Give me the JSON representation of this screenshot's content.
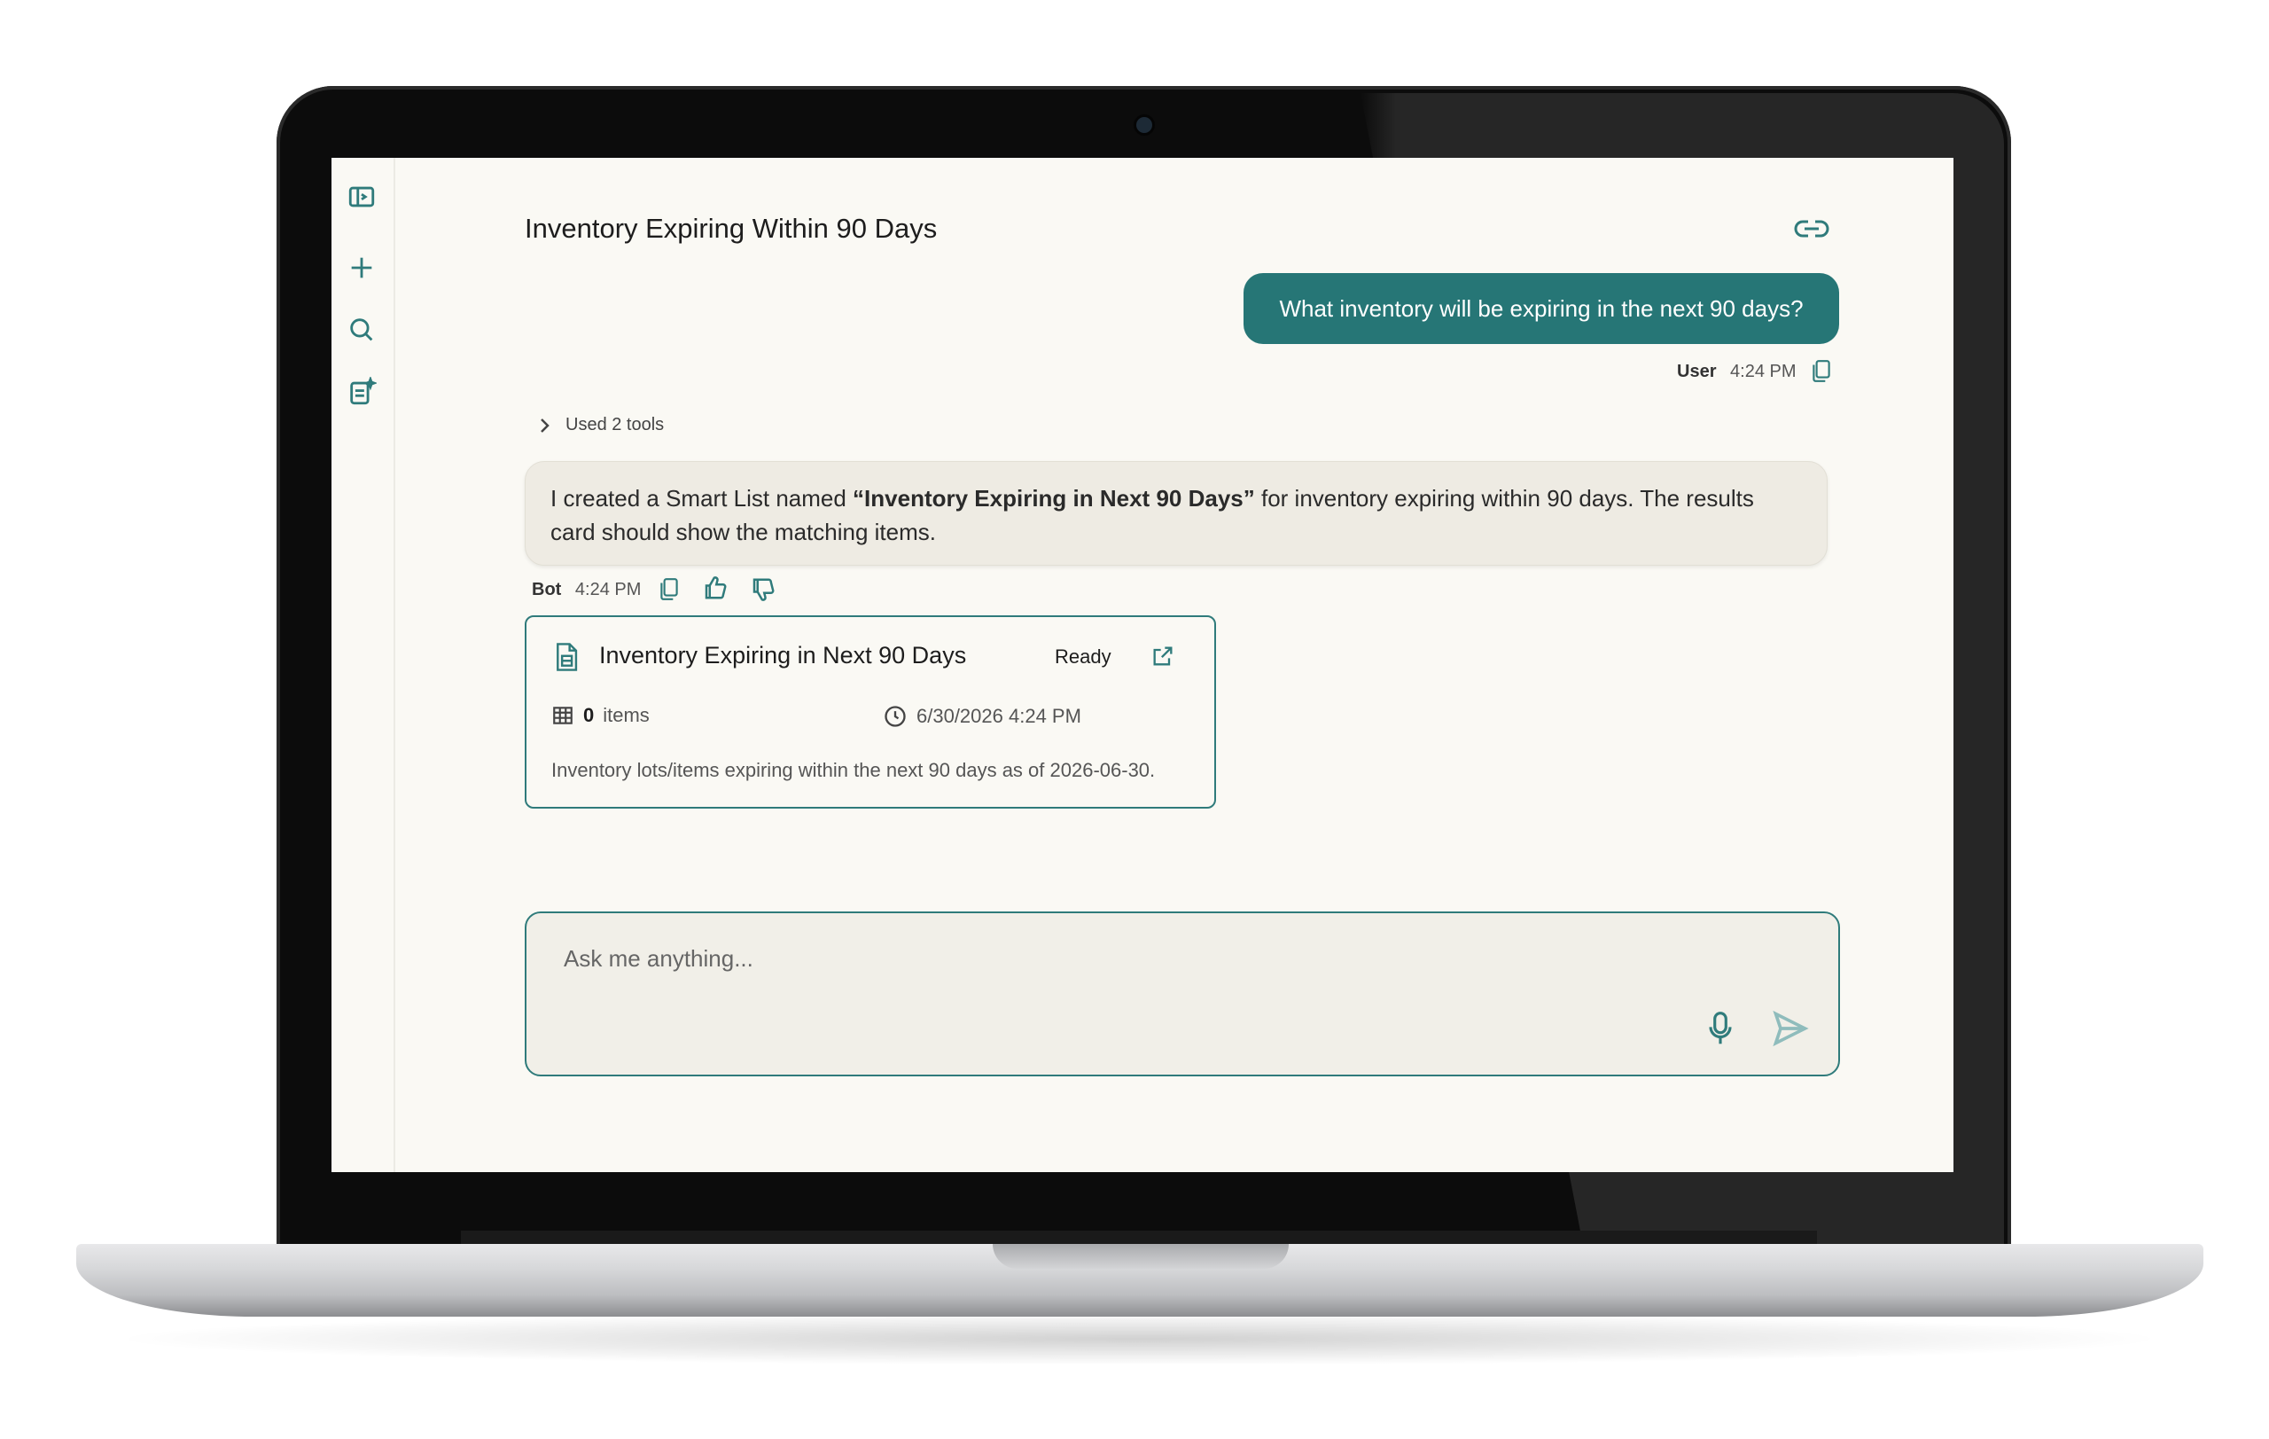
{
  "conversation": {
    "title": "Inventory Expiring Within 90 Days"
  },
  "user_message": {
    "text": "What inventory will be expiring in the next 90 days?",
    "sender": "User",
    "time": "4:24 PM"
  },
  "tools": {
    "label": "Used 2 tools"
  },
  "bot_message": {
    "prefix": "I created a Smart List named ",
    "highlight": "“Inventory Expiring in Next 90 Days”",
    "suffix": " for inventory expiring within 90 days. The results card should show the matching items.",
    "sender": "Bot",
    "time": "4:24 PM"
  },
  "result_card": {
    "title": "Inventory Expiring in Next 90 Days",
    "status": "Ready",
    "item_count": "0",
    "item_label": "items",
    "timestamp": "6/30/2026 4:24 PM",
    "description": "Inventory lots/items expiring within the next 90 days as of 2026-06-30."
  },
  "composer": {
    "placeholder": "Ask me anything..."
  },
  "icons": {
    "sidebar_toggle": "sidebar-toggle-icon",
    "new_chat": "plus-icon",
    "search": "search-icon",
    "smart_list": "clipboard-sparkle-icon",
    "share_link": "link-icon",
    "copy": "copy-icon",
    "thumbs_up": "thumbs-up-icon",
    "thumbs_down": "thumbs-down-icon",
    "open_external": "external-link-icon",
    "microphone": "microphone-icon",
    "send": "send-icon"
  },
  "colors": {
    "accent": "#267676",
    "screen_bg": "#faf9f4",
    "bot_bubble": "#eeebe3"
  }
}
